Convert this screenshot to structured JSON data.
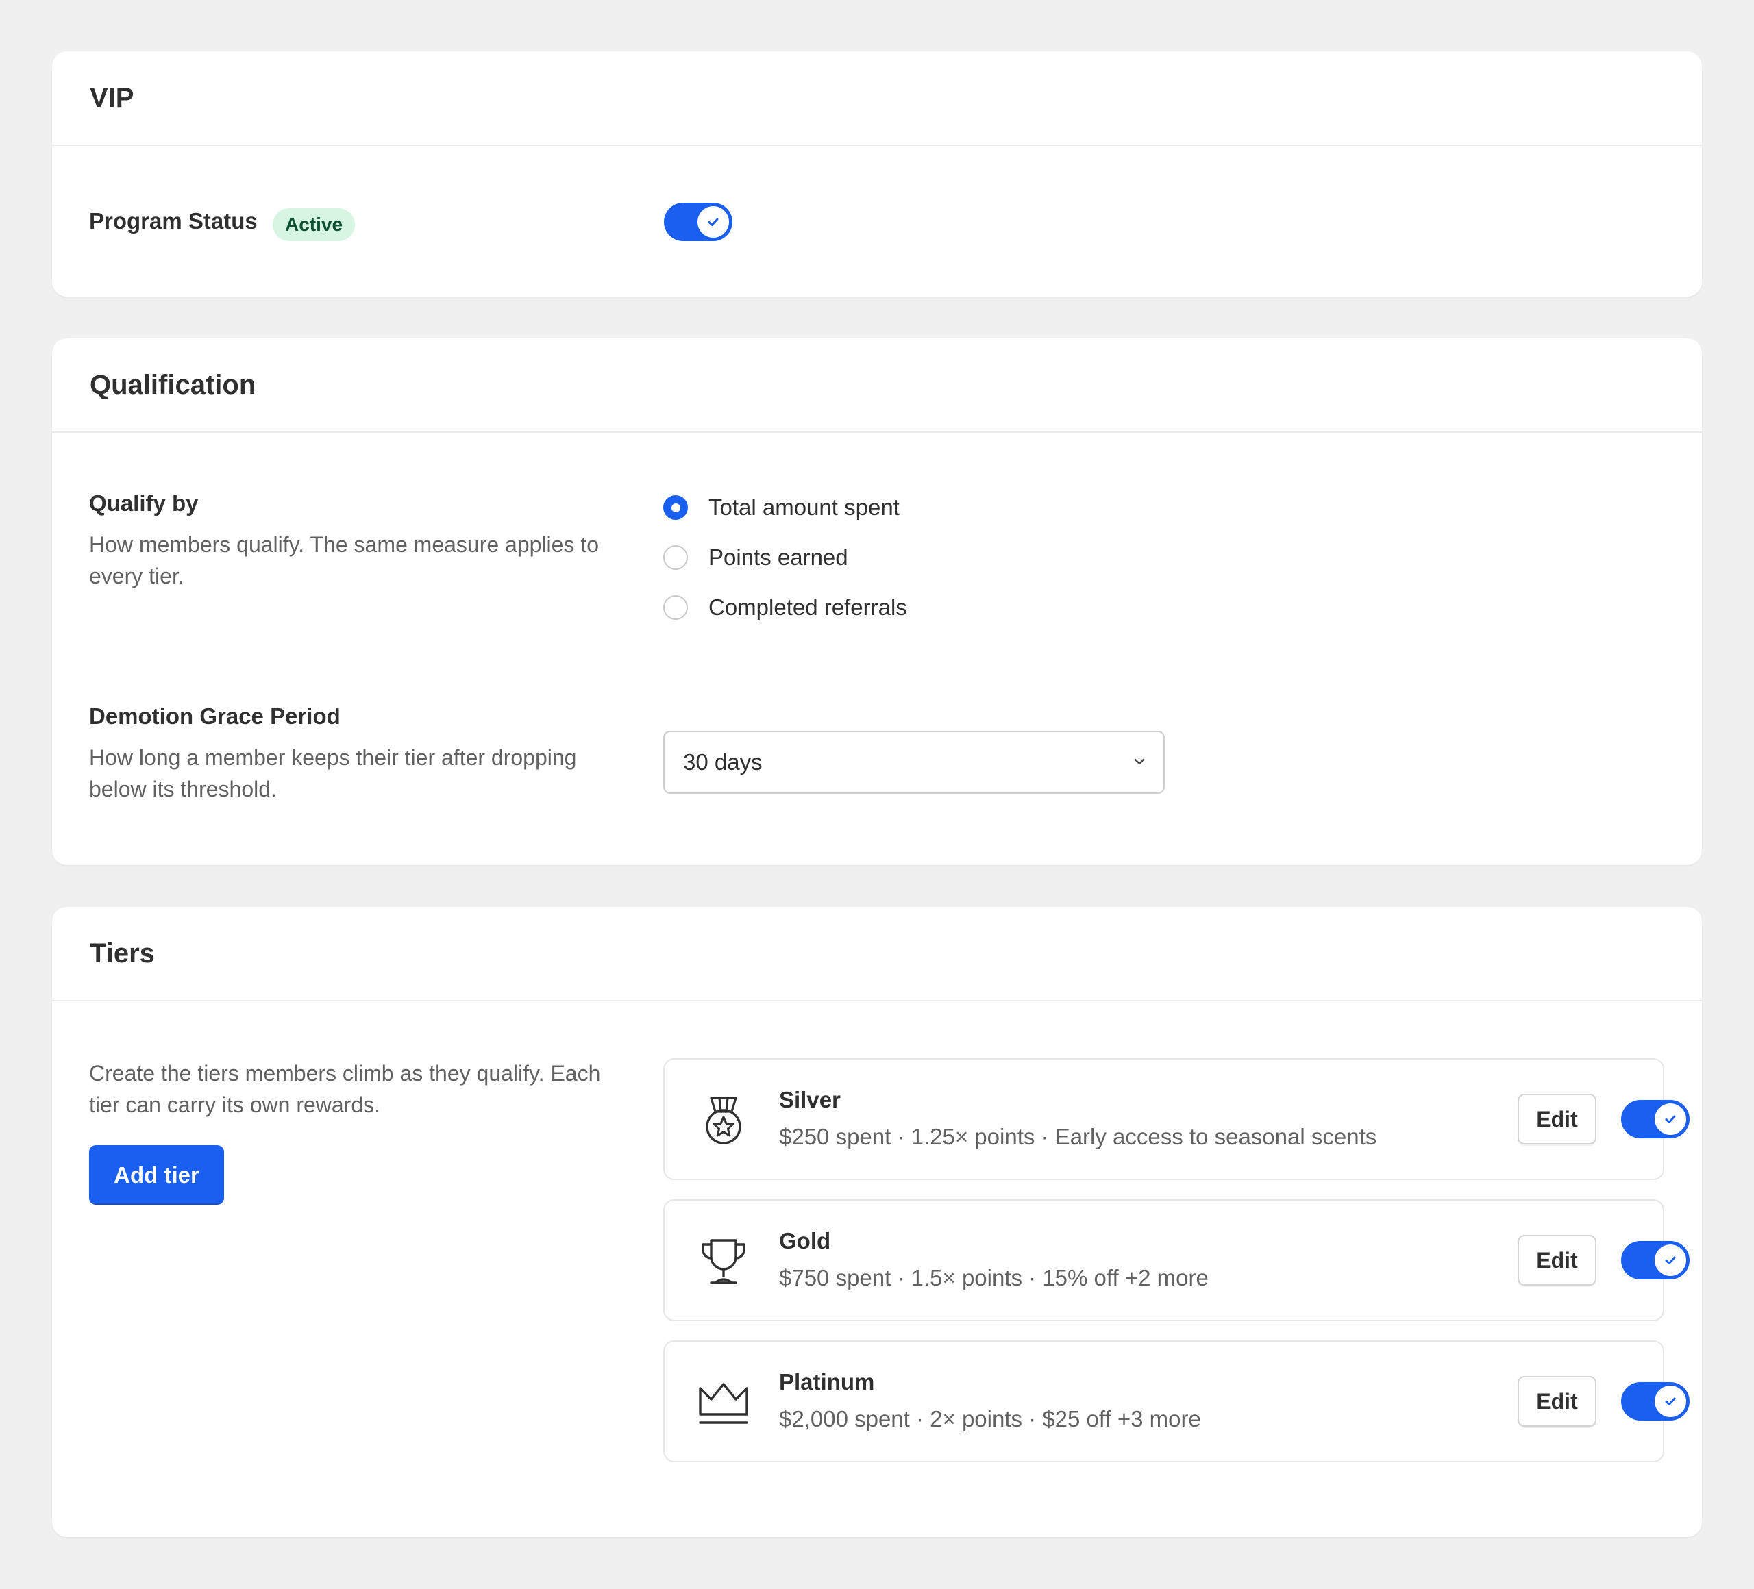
{
  "vip": {
    "title": "VIP",
    "program_status_label": "Program Status",
    "status_badge": "Active",
    "program_enabled": true
  },
  "qualification": {
    "title": "Qualification",
    "qualify_by": {
      "label": "Qualify by",
      "description": "How members qualify. The same measure applies to every tier.",
      "options": [
        {
          "label": "Total amount spent",
          "checked": true
        },
        {
          "label": "Points earned",
          "checked": false
        },
        {
          "label": "Completed referrals",
          "checked": false
        }
      ]
    },
    "grace_period": {
      "label": "Demotion Grace Period",
      "description": "How long a member keeps their tier after dropping below its threshold.",
      "selected": "30 days"
    }
  },
  "tiers": {
    "title": "Tiers",
    "description": "Create the tiers members climb as they qualify. Each tier can carry its own rewards.",
    "add_button": "Add tier",
    "items": [
      {
        "name": "Silver",
        "meta": "$250 spent · 1.25× points · Early access to seasonal scents",
        "icon": "medal-icon",
        "edit_label": "Edit",
        "enabled": true
      },
      {
        "name": "Gold",
        "meta": "$750 spent · 1.5× points · 15% off +2 more",
        "icon": "trophy-icon",
        "edit_label": "Edit",
        "enabled": true
      },
      {
        "name": "Platinum",
        "meta": "$2,000 spent · 2× points · $25 off +3 more",
        "icon": "crown-icon",
        "edit_label": "Edit",
        "enabled": true
      }
    ]
  },
  "colors": {
    "accent": "#1a5ff0",
    "badge_bg": "#d6f5e3",
    "badge_text": "#0c5132",
    "page_bg": "#f0f0f0"
  }
}
